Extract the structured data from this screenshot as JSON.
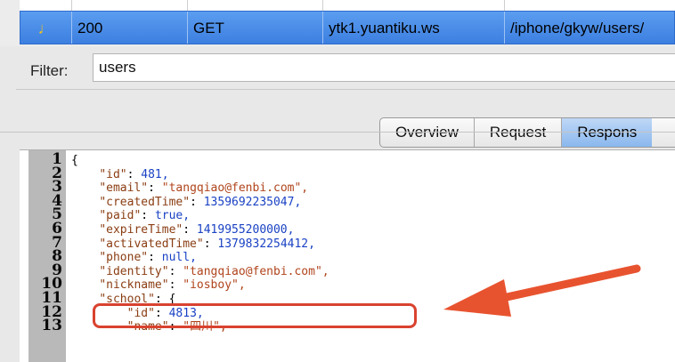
{
  "request_row": {
    "status": "200",
    "method": "GET",
    "host": "ytk1.yuantiku.ws",
    "path": "/iphone/gkyw/users/"
  },
  "filter": {
    "label": "Filter:",
    "value": "users"
  },
  "tabs": [
    {
      "label": "Overview",
      "active": false
    },
    {
      "label": "Request",
      "active": false
    },
    {
      "label": "Respons",
      "active": true
    }
  ],
  "code": {
    "line_numbers": [
      "1",
      "2",
      "3",
      "4",
      "5",
      "6",
      "7",
      "8",
      "9",
      "10",
      "11",
      "12",
      "13"
    ],
    "lines": [
      {
        "key": "",
        "sep": "{",
        "val": "",
        "vtype": "p",
        "indent": ""
      },
      {
        "key": "\"id\"",
        "sep": ": ",
        "val": "481,",
        "vtype": "n",
        "indent": "    "
      },
      {
        "key": "\"email\"",
        "sep": ": ",
        "val": "\"tangqiao@fenbi.com\",",
        "vtype": "s",
        "indent": "    "
      },
      {
        "key": "\"createdTime\"",
        "sep": ": ",
        "val": "1359692235047,",
        "vtype": "n",
        "indent": "    "
      },
      {
        "key": "\"paid\"",
        "sep": ": ",
        "val": "true,",
        "vtype": "b",
        "indent": "    "
      },
      {
        "key": "\"expireTime\"",
        "sep": ": ",
        "val": "1419955200000,",
        "vtype": "n",
        "indent": "    "
      },
      {
        "key": "\"activatedTime\"",
        "sep": ": ",
        "val": "1379832254412,",
        "vtype": "n",
        "indent": "    "
      },
      {
        "key": "\"phone\"",
        "sep": ": ",
        "val": "null,",
        "vtype": "b",
        "indent": "    "
      },
      {
        "key": "\"identity\"",
        "sep": ": ",
        "val": "\"tangqiao@fenbi.com\",",
        "vtype": "s",
        "indent": "    "
      },
      {
        "key": "\"nickname\"",
        "sep": ": ",
        "val": "\"iosboy\",",
        "vtype": "s",
        "indent": "    "
      },
      {
        "key": "\"school\"",
        "sep": ": ",
        "val": "{",
        "vtype": "p",
        "indent": "    "
      },
      {
        "key": "\"id\"",
        "sep": ": ",
        "val": "4813,",
        "vtype": "n",
        "indent": "        "
      },
      {
        "key": "\"name\"",
        "sep": ": ",
        "val": "\"四川\",",
        "vtype": "s",
        "indent": "        "
      }
    ]
  },
  "colors": {
    "highlight": "#d9422f",
    "arrow": "#e8532f",
    "selection": "#3c7fe0"
  }
}
